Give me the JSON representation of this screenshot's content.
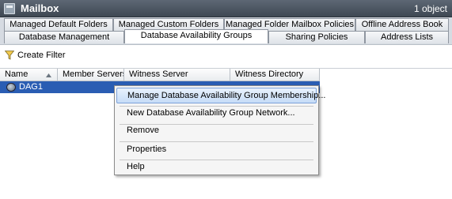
{
  "header": {
    "title": "Mailbox",
    "count": "1 object",
    "icon": "mailbox-icon"
  },
  "tabs": {
    "row1": [
      "Managed Default Folders",
      "Managed Custom Folders",
      "Managed Folder Mailbox Policies",
      "Offline Address Book"
    ],
    "row2": [
      "Database Management",
      "Database Availability Groups",
      "Sharing Policies",
      "Address Lists"
    ],
    "active": "Database Availability Groups"
  },
  "toolbar": {
    "filter_label": "Create Filter",
    "filter_icon": "funnel-icon"
  },
  "grid": {
    "columns": [
      "Name",
      "Member Servers",
      "Witness Server",
      "Witness Directory"
    ],
    "rows": [
      {
        "name": "DAG1",
        "icon": "database-availability-group-icon"
      }
    ]
  },
  "context_menu": {
    "items": [
      "Manage Database Availability Group Membership...",
      "New Database Availability Group Network...",
      "Remove",
      "Properties",
      "Help"
    ],
    "highlighted": "Manage Database Availability Group Membership..."
  },
  "colors": {
    "header_bg": "#4b5561",
    "selection": "#2a5db3",
    "menu_highlight": "#c6dcf7"
  }
}
